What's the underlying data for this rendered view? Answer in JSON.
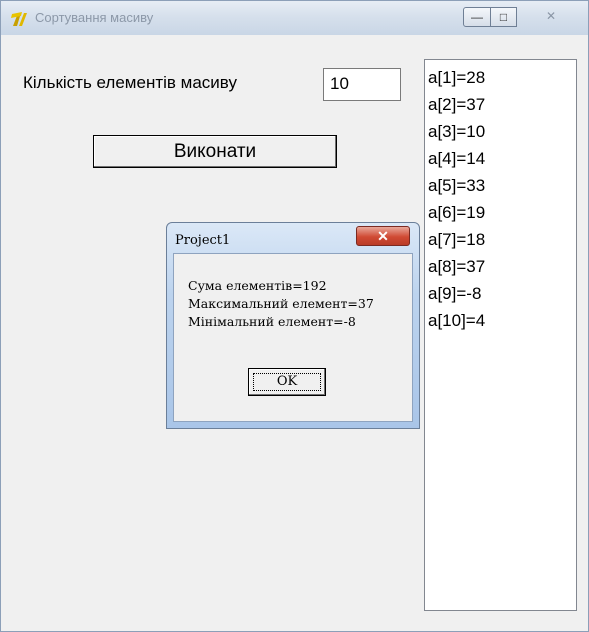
{
  "window": {
    "title": "Сортування масиву",
    "controls": {
      "minimize": "—",
      "maximize": "□",
      "close": "✕"
    }
  },
  "form": {
    "count_label": "Кількість елементів масиву",
    "count_value": "10",
    "execute_label": "Виконати"
  },
  "list": {
    "items": [
      "a[1]=28",
      "a[2]=37",
      "a[3]=10",
      "a[4]=14",
      "a[5]=33",
      "a[6]=19",
      "a[7]=18",
      "a[8]=37",
      "a[9]=-8",
      "a[10]=4"
    ]
  },
  "dialog": {
    "title": "Project1",
    "close_glyph": "✕",
    "lines": [
      "Сума елементів=192",
      "Максимальний елемент=37",
      "Мінімальний елемент=-8"
    ],
    "ok_label": "OK"
  },
  "colors": {
    "titlebar": "#d6e0ec",
    "dialog_close": "#d04a34",
    "window_bg": "#f0f0f0"
  }
}
